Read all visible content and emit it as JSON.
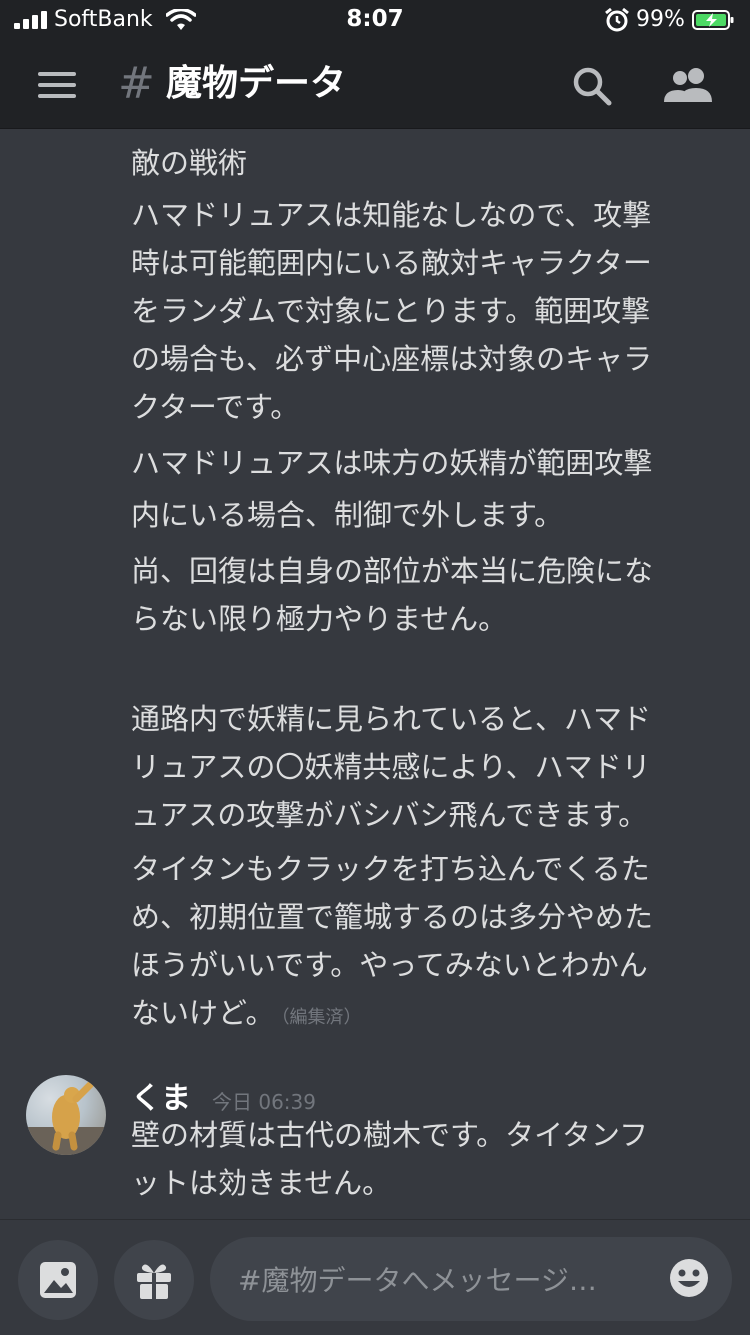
{
  "status_bar": {
    "carrier": "SoftBank",
    "time": "8:07",
    "battery_percent": "99%"
  },
  "header": {
    "channel_hash": "#",
    "channel_name": "魔物データ",
    "icons": [
      "menu-icon",
      "search-icon",
      "members-icon"
    ]
  },
  "messages": {
    "block1": {
      "lines": [
        "敵の戦術",
        "ハマドリュアスは知能なしなので、攻撃",
        "時は可能範囲内にいる敵対キャラクター",
        "をランダムで対象にとります。範囲攻撃",
        "の場合も、必ず中心座標は対象のキャラ",
        "クターです。",
        "ハマドリュアスは味方の妖精が範囲攻撃",
        "内にいる場合、制御で外します。",
        "尚、回復は自身の部位が本当に危険にな",
        "らない限り極力やりません。",
        "通路内で妖精に見られていると、ハマド",
        "リュアスの〇妖精共感により、ハマドリ",
        "ュアスの攻撃がバシバシ飛んできます。",
        "タイタンもクラックを打ち込んでくるた",
        "め、初期位置で籠城するのは多分やめた",
        "ほうがいいです。やってみないとわかん",
        "ないけど。"
      ],
      "edited": "（編集済）"
    },
    "message2": {
      "username": "くま",
      "timestamp": "今日 06:39",
      "lines": [
        "壁の材質は古代の樹木です。タイタンフ",
        "ットは効きません。"
      ]
    }
  },
  "composer": {
    "placeholder": "#魔物データへメッセージ…",
    "icons": [
      "image-icon",
      "gift-icon",
      "emoji-icon"
    ]
  },
  "colors": {
    "background": "#36393f",
    "header_bg": "#202225",
    "text": "#dcddde",
    "muted": "#72767d",
    "input_bg": "#40444b",
    "battery_green": "#4cd964"
  }
}
